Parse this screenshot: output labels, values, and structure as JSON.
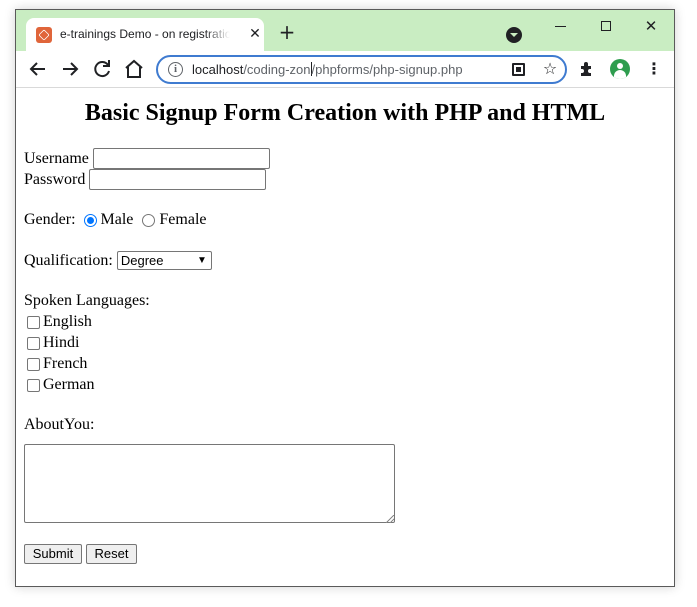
{
  "browser": {
    "tab_title": "e-trainings Demo - on registration",
    "tab_close": "✕",
    "new_tab": "+",
    "window_close": "✕",
    "url_host": "localhost",
    "url_path_1": "/coding-zon",
    "url_path_2": "/phpforms/php-signup.php",
    "menu_glyph": "⋮"
  },
  "form": {
    "title": "Basic Signup Form Creation with PHP and HTML",
    "username_label": "Username",
    "username_value": "",
    "password_label": "Password",
    "password_value": "",
    "gender_label": "Gender:",
    "gender_options": [
      "Male",
      "Female"
    ],
    "gender_selected": "Male",
    "qualification_label": "Qualification:",
    "qualification_selected": "Degree",
    "languages_label": "Spoken Languages:",
    "languages": [
      "English",
      "Hindi",
      "French",
      "German"
    ],
    "about_label": "AboutYou:",
    "about_value": "",
    "submit_label": "Submit",
    "reset_label": "Reset"
  },
  "colors": {
    "titlebar_bg": "#c9edc2",
    "accent": "#0075ff",
    "omnibox_border": "#3f7bd0"
  }
}
